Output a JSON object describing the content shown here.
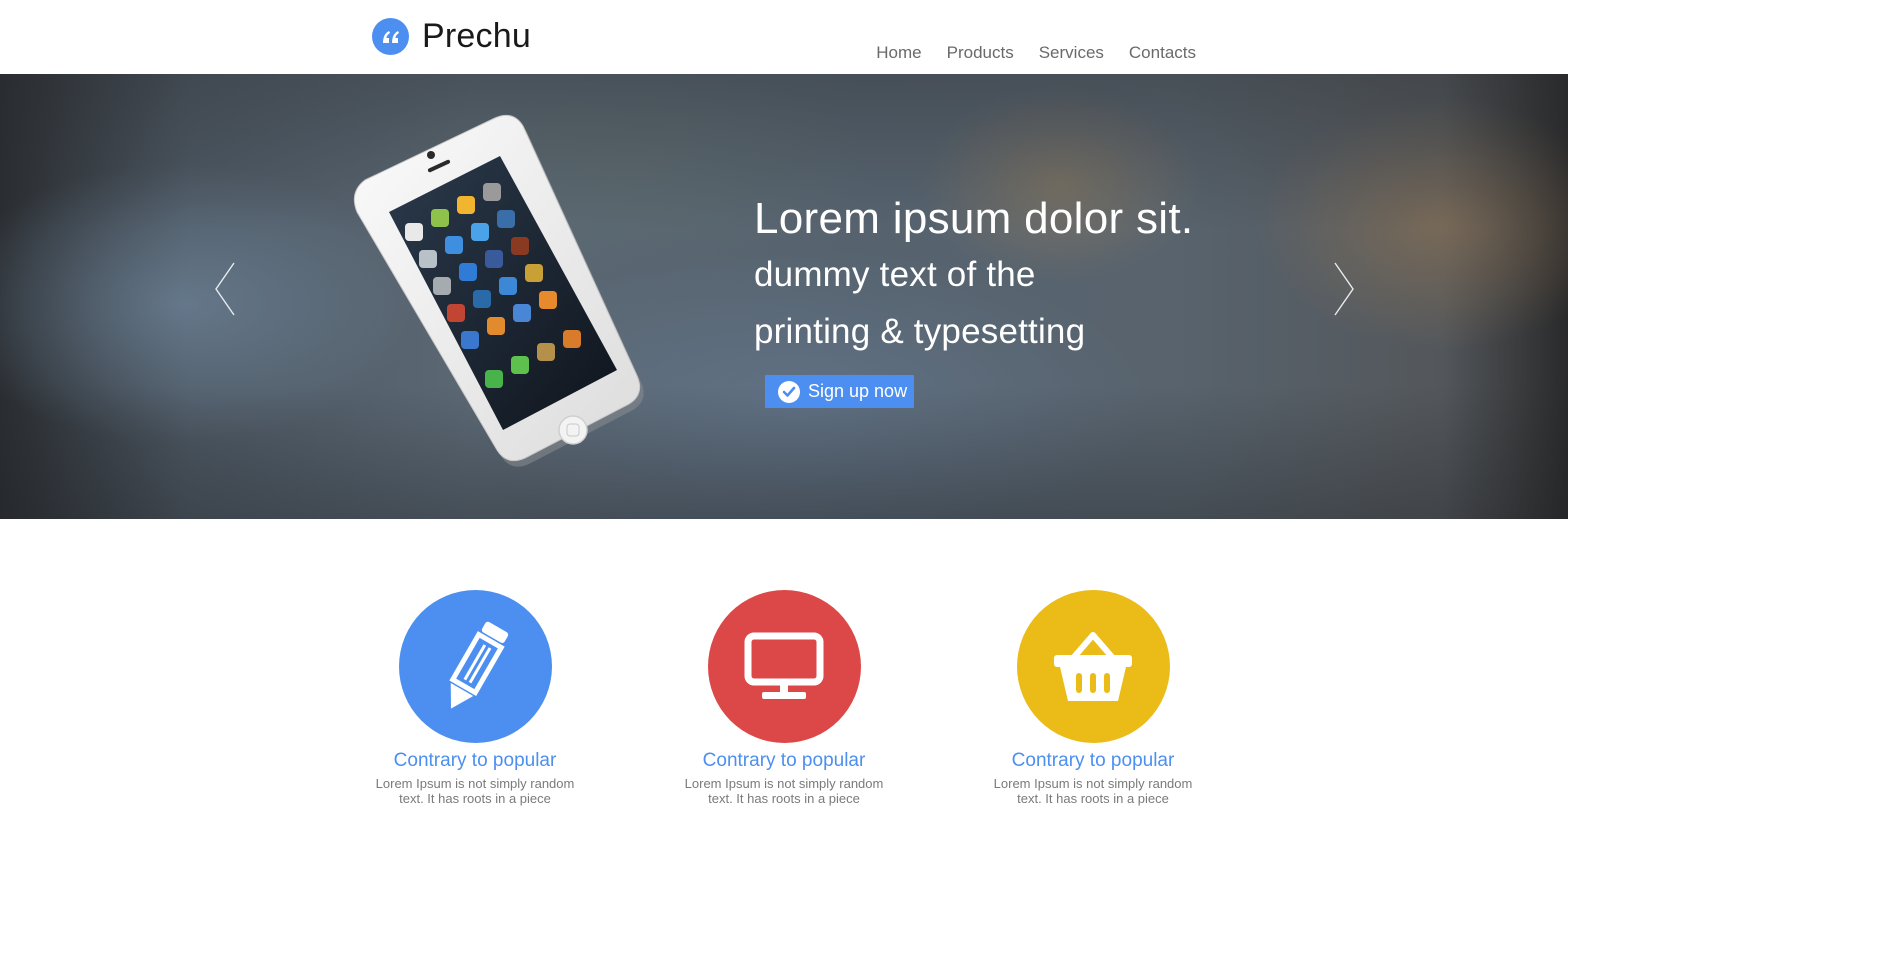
{
  "header": {
    "logo_text": "Prechu",
    "logo_icon": "quote-icon",
    "nav": [
      {
        "label": "Home"
      },
      {
        "label": "Products"
      },
      {
        "label": "Services"
      },
      {
        "label": "Contacts"
      }
    ]
  },
  "hero": {
    "title": "Lorem ipsum dolor sit.",
    "subtitle_line1": "dummy text of the",
    "subtitle_line2": "printing & typesetting",
    "cta_label": "Sign up now",
    "cta_icon": "check-circle-icon",
    "prev_icon": "chevron-left-icon",
    "next_icon": "chevron-right-icon",
    "image": "iphone-device-image"
  },
  "features": [
    {
      "title": "Contrary to popular",
      "text": "Lorem Ipsum is not simply random text. It has roots in a piece",
      "icon": "pencil-icon",
      "color": "#4c8ff0"
    },
    {
      "title": "Contrary to popular",
      "text": "Lorem Ipsum is not simply random text. It has roots in a piece",
      "icon": "monitor-icon",
      "color": "#dc4848"
    },
    {
      "title": "Contrary to popular",
      "text": "Lorem Ipsum is not simply random text. It has roots in a piece",
      "icon": "basket-icon",
      "color": "#ebbb17"
    }
  ],
  "colors": {
    "accent": "#4c8ff0",
    "red": "#dc4848",
    "yellow": "#ebbb17"
  }
}
